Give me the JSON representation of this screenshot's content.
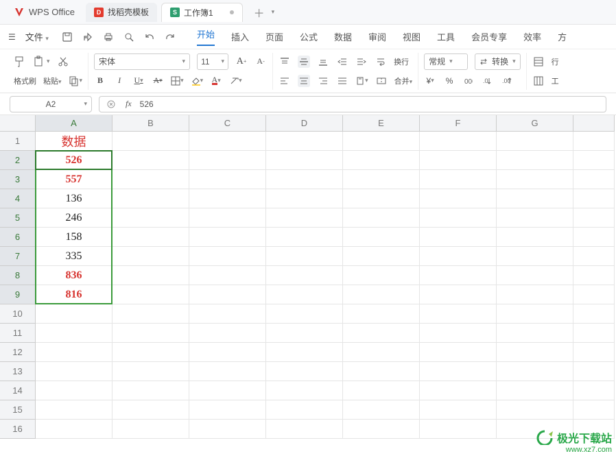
{
  "titlebar": {
    "app_name": "WPS Office",
    "tabs": [
      {
        "label": "找稻壳模板",
        "color": "#e33b2e",
        "letter": "D"
      },
      {
        "label": "工作簿1",
        "color": "#2e9e6f",
        "letter": "S",
        "active": true
      }
    ]
  },
  "menubar": {
    "file_label": "文件",
    "tabs": [
      "开始",
      "插入",
      "页面",
      "公式",
      "数据",
      "审阅",
      "视图",
      "工具",
      "会员专享",
      "效率",
      "方"
    ]
  },
  "ribbon": {
    "clipboard": {
      "format_painter": "格式刷",
      "paste": "粘贴"
    },
    "font": {
      "name": "宋体",
      "size": "11"
    },
    "align": {
      "wrap": "换行",
      "merge": "合并"
    },
    "number": {
      "format": "常规",
      "convert": "转换"
    },
    "cells": {
      "row": "行",
      "worksheet": "工"
    },
    "currency": "¥",
    "percent": "%"
  },
  "namebox": {
    "ref": "A2",
    "formula": "526"
  },
  "grid": {
    "active_cell": "A2",
    "columns": [
      "A",
      "B",
      "C",
      "D",
      "E",
      "F",
      "G"
    ],
    "rows": 16,
    "selection": {
      "col": 0,
      "row_start": 1,
      "row_end": 8
    },
    "header_cell": {
      "row": 0,
      "col": 0,
      "value": "数据",
      "style": "header"
    },
    "data": [
      {
        "row": 1,
        "col": 0,
        "value": "526",
        "style": "red"
      },
      {
        "row": 2,
        "col": 0,
        "value": "557",
        "style": "red"
      },
      {
        "row": 3,
        "col": 0,
        "value": "136",
        "style": "black"
      },
      {
        "row": 4,
        "col": 0,
        "value": "246",
        "style": "black"
      },
      {
        "row": 5,
        "col": 0,
        "value": "158",
        "style": "black"
      },
      {
        "row": 6,
        "col": 0,
        "value": "335",
        "style": "black"
      },
      {
        "row": 7,
        "col": 0,
        "value": "836",
        "style": "red"
      },
      {
        "row": 8,
        "col": 0,
        "value": "816",
        "style": "red"
      }
    ]
  },
  "watermark": {
    "line1": "极光下载站",
    "line2": "www.xz7.com"
  }
}
